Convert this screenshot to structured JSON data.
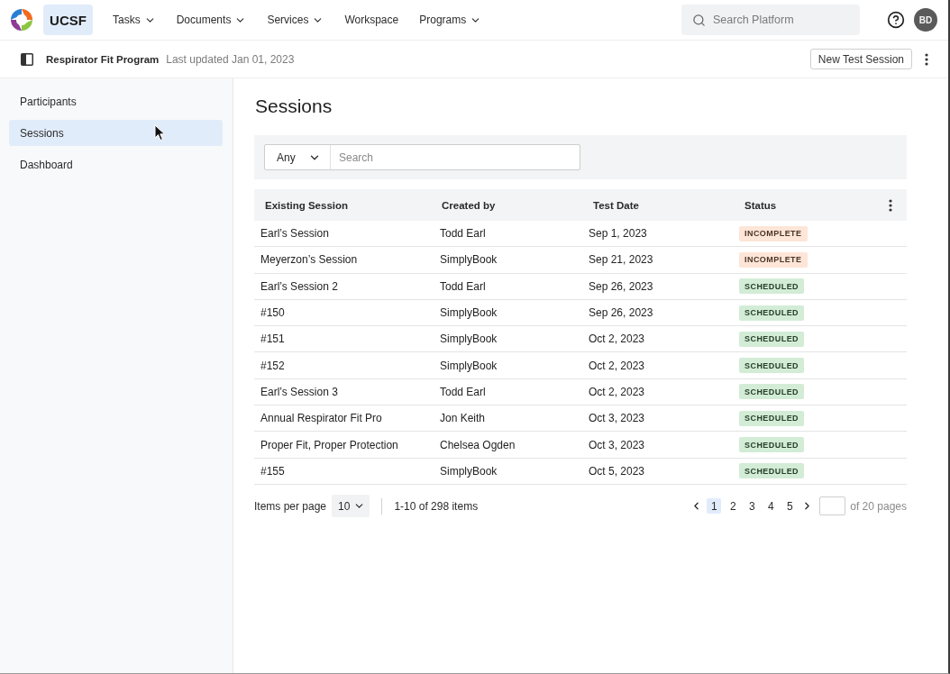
{
  "top_nav": {
    "brand": "UCSF",
    "menu": [
      {
        "label": "Tasks",
        "has_dropdown": true
      },
      {
        "label": "Documents",
        "has_dropdown": true
      },
      {
        "label": "Services",
        "has_dropdown": true
      },
      {
        "label": "Workspace",
        "has_dropdown": false
      },
      {
        "label": "Programs",
        "has_dropdown": true
      }
    ],
    "search": {
      "placeholder": "Search Platform"
    },
    "avatar": "BD"
  },
  "program_bar": {
    "title": "Respirator Fit Program",
    "last_updated": "Last updated Jan 01, 2023",
    "button": "New Test Session"
  },
  "sidebar": {
    "items": [
      {
        "label": "Participants",
        "selected": false
      },
      {
        "label": "Sessions",
        "selected": true
      },
      {
        "label": "Dashboard",
        "selected": false
      }
    ]
  },
  "content": {
    "title": "Sessions",
    "filter": {
      "scope": "Any",
      "placeholder": "Search"
    },
    "table": {
      "columns": [
        "Existing Session",
        "Created by",
        "Test Date",
        "Status"
      ],
      "rows": [
        {
          "session": "Earl’s Session",
          "created_by": "Todd Earl",
          "test_date": "Sep 1, 2023",
          "status": {
            "label": "INCOMPLETE",
            "kind": "incomplete"
          }
        },
        {
          "session": "Meyerzon’s Session",
          "created_by": "SimplyBook",
          "test_date": "Sep 21, 2023",
          "status": {
            "label": "INCOMPLETE",
            "kind": "incomplete"
          }
        },
        {
          "session": "Earl’s Session 2",
          "created_by": "Todd Earl",
          "test_date": "Sep 26, 2023",
          "status": {
            "label": "SCHEDULED",
            "kind": "scheduled"
          }
        },
        {
          "session": "#150",
          "created_by": "SimplyBook",
          "test_date": "Sep 26, 2023",
          "status": {
            "label": "SCHEDULED",
            "kind": "scheduled"
          }
        },
        {
          "session": "#151",
          "created_by": "SimplyBook",
          "test_date": "Oct 2, 2023",
          "status": {
            "label": "SCHEDULED",
            "kind": "scheduled"
          }
        },
        {
          "session": "#152",
          "created_by": "SimplyBook",
          "test_date": "Oct 2, 2023",
          "status": {
            "label": "SCHEDULED",
            "kind": "scheduled"
          }
        },
        {
          "session": "Earl’s Session 3",
          "created_by": "Todd Earl",
          "test_date": "Oct 2, 2023",
          "status": {
            "label": "SCHEDULED",
            "kind": "scheduled"
          }
        },
        {
          "session": "Annual Respirator Fit Pro",
          "created_by": "Jon Keith",
          "test_date": "Oct 3, 2023",
          "status": {
            "label": "SCHEDULED",
            "kind": "scheduled"
          }
        },
        {
          "session": "Proper Fit, Proper Protection",
          "created_by": "Chelsea Ogden",
          "test_date": "Oct 3, 2023",
          "status": {
            "label": "SCHEDULED",
            "kind": "scheduled"
          }
        },
        {
          "session": "#155",
          "created_by": "SimplyBook",
          "test_date": "Oct 5, 2023",
          "status": {
            "label": "SCHEDULED",
            "kind": "scheduled"
          }
        }
      ]
    },
    "pagination": {
      "items_per_page_label": "Items per page",
      "page_size": "10",
      "range": "1-10 of 298 items",
      "pages": [
        {
          "label": "1",
          "selected": true
        },
        {
          "label": "2",
          "selected": false
        },
        {
          "label": "3",
          "selected": false
        },
        {
          "label": "4",
          "selected": false
        },
        {
          "label": "5",
          "selected": false
        }
      ],
      "page_total": "of 20 pages"
    }
  }
}
